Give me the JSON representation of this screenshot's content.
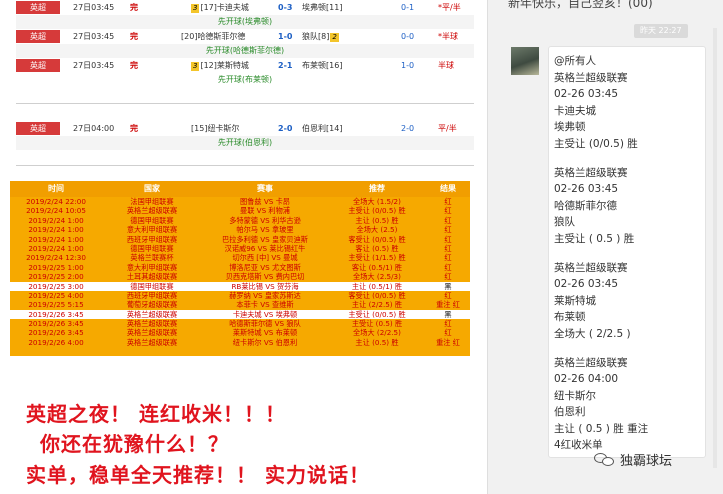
{
  "score_rows": [
    {
      "league": "英超",
      "time": "27日03:45",
      "status": "完",
      "home_rank": "17",
      "home": "卡迪夫城",
      "score": "0-3",
      "away": "埃弗顿",
      "away_rank": "11",
      "half": "0-1",
      "pan": "*平/半",
      "info": "先开球(埃弗顿)"
    },
    {
      "league": "英超",
      "time": "27日03:45",
      "status": "完",
      "home_rank": "20",
      "home": "哈德斯菲尔德",
      "score": "1-0",
      "away": "狼队",
      "away_rank": "8",
      "half": "0-0",
      "pan": "*半球",
      "info": "先开球(哈德斯菲尔德)"
    },
    {
      "league": "英超",
      "time": "27日03:45",
      "status": "完",
      "home_rank": "12",
      "home": "莱斯特城",
      "score": "2-1",
      "away": "布莱顿",
      "away_rank": "16",
      "half": "1-0",
      "pan": "半球",
      "info": "先开球(布莱顿)"
    },
    {
      "league": "英超",
      "time": "27日04:00",
      "status": "完",
      "home_rank": "15",
      "home": "纽卡斯尔",
      "score": "2-0",
      "away": "伯恩利",
      "away_rank": "14",
      "half": "2-0",
      "pan": "平/半",
      "info": "先开球(伯恩利)"
    }
  ],
  "rec_table": {
    "headers": [
      "时间",
      "国家",
      "赛事",
      "推荐",
      "结果"
    ],
    "rows": [
      [
        "2019/2/24 22:00",
        "法国甲组联赛",
        "图鲁兹 VS 卡昂",
        "全场大 (1.5/2)",
        "红"
      ],
      [
        "2019/2/24 10:05",
        "英格兰超级联赛",
        "曼联 VS 利物浦",
        "主受让 (0/0.5)  胜",
        "红"
      ],
      [
        "2019/2/24 1:00",
        "德国甲组联赛",
        "多特蒙德 VS 利华古逊",
        "主让 (0.5) 胜",
        "红"
      ],
      [
        "2019/2/24 1:00",
        "意大利甲组联赛",
        "帕尔马 VS 拿玻里",
        "全场大 (2.5)",
        "红"
      ],
      [
        "2019/2/24 1:00",
        "西班牙甲组联赛",
        "巴拉多利德 VS 皇家贝迪斯",
        "客受让 (0/0.5) 胜",
        "红"
      ],
      [
        "2019/2/24 1:00",
        "德国甲组联赛",
        "汉诺威96 VS 莱比锡红牛",
        "客让 (0.5) 胜",
        "红"
      ],
      [
        "2019/2/24 12:30",
        "英格兰联赛杯",
        "切尔西 [中] VS 曼城",
        "主受让 (1/1.5) 胜",
        "红"
      ],
      [
        "2019/2/25 1:00",
        "意大利甲组联赛",
        "博洛尼亚 VS 尤文图斯",
        "客让 (0.5/1) 胜",
        "红"
      ],
      [
        "2019/2/25 2:00",
        "土耳其超级联赛",
        "贝西克塔斯 VS 费内巴切",
        "全场大 (2.5/3)",
        "红"
      ],
      [
        "2019/2/25 3:00",
        "德国甲组联赛",
        "RB莱比锡 VS 贺芬海",
        "主让 (0.5/1) 胜",
        "黑"
      ],
      [
        "2019/2/25 4:00",
        "西班牙甲组联赛",
        "赫罗纳 VS 皇家苏斯达",
        "客受让 (0/0.5) 胜",
        "红"
      ],
      [
        "2019/2/25 5:15",
        "葡萄牙超级联赛",
        "本菲卡 VS 查维斯",
        "主让 (2/2.5) 胜",
        "重注 红"
      ],
      [
        "2019/2/26 3:45",
        "英格兰超级联赛",
        "卡迪夫城 VS 埃弗顿",
        "主受让 (0/0.5) 胜",
        "黑"
      ],
      [
        "2019/2/26 3:45",
        "英格兰超级联赛",
        "哈德斯菲尔德 VS 狼队",
        "主受让 (0.5) 胜",
        "红"
      ],
      [
        "2019/2/26 3:45",
        "英格兰超级联赛",
        "莱斯特城 VS 布莱顿",
        "全场大 (2/2.5)",
        "红"
      ],
      [
        "2019/2/26 4:00",
        "英格兰超级联赛",
        "纽卡斯尔 VS 伯恩利",
        "主让 (0.5) 胜",
        "重注 红"
      ]
    ]
  },
  "promo": {
    "line1": "英超之夜！ 连红收米！！！",
    "line2": "你还在犹豫什么！？",
    "line3": "实单，稳单全天推荐！！ 实力说话！"
  },
  "chat": {
    "top_text": "新年快乐，自己翌亥！(00)",
    "timestamp": "昨天 22:27",
    "message_lines": [
      "@所有人",
      "英格兰超级联赛",
      "02-26   03:45",
      "卡迪夫城",
      "埃弗顿",
      "主受让 (0/0.5) 胜",
      "",
      "英格兰超级联赛",
      "02-26   03:45",
      "哈德斯菲尔德",
      "狼队",
      "主受让 ( 0.5 ) 胜",
      "",
      "英格兰超级联赛",
      "02-26   03:45",
      "莱斯特城",
      "布莱顿",
      "全场大 ( 2/2.5 )",
      "",
      "英格兰超级联赛",
      "02-26   04:00",
      "纽卡斯尔",
      "伯恩利",
      "主让 ( 0.5 ) 胜          重注",
      "4红收米单"
    ],
    "watermark": "独霸球坛"
  }
}
